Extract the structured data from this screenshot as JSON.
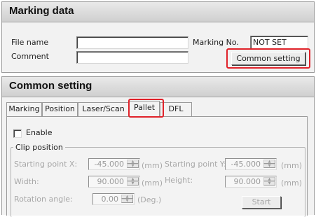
{
  "marking_data": {
    "title": "Marking data",
    "file_name_label": "File name",
    "file_name_value": "",
    "comment_label": "Comment",
    "comment_value": "",
    "marking_no_label": "Marking No.",
    "marking_no_value": "NOT SET",
    "common_setting_button": "Common setting"
  },
  "common_setting": {
    "title": "Common setting",
    "tabs": [
      {
        "label": "Marking",
        "active": false
      },
      {
        "label": "Position",
        "active": false
      },
      {
        "label": "Laser/Scan",
        "active": false
      },
      {
        "label": "Pallet",
        "active": true
      },
      {
        "label": "DFL",
        "active": false
      }
    ],
    "enable_label": "Enable",
    "enable_checked": false,
    "clip_position": {
      "group_label": "Clip position",
      "start_x_label": "Starting point X:",
      "start_x_value": "-45.000",
      "start_y_label": "Starting point Y:",
      "start_y_value": "-45.000",
      "width_label": "Width:",
      "width_value": "90.000",
      "height_label": "Height:",
      "height_value": "90.000",
      "rotation_label": "Rotation angle:",
      "rotation_value": "0.00",
      "unit_mm": "(mm)",
      "unit_deg": "(Deg.)",
      "start_button": "Start"
    }
  },
  "highlight_color": "#e0222a"
}
